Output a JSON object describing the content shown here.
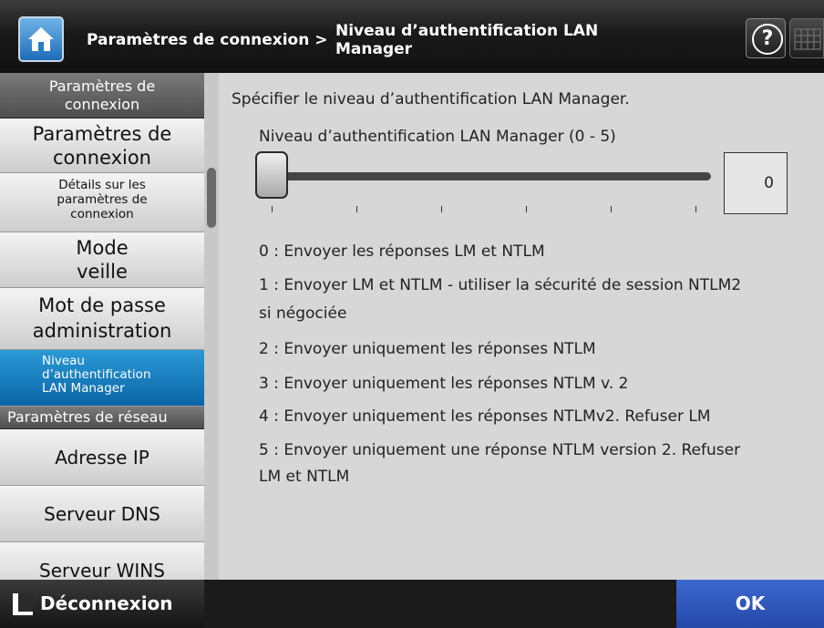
{
  "header": {
    "breadcrumb_parent": "Paramètres de connexion",
    "breadcrumb_separator": ">",
    "breadcrumb_current_line1": "Niveau d’authentification LAN",
    "breadcrumb_current_line2": "Manager",
    "help_glyph": "?"
  },
  "sidebar": {
    "section_connexion": [
      "Paramètres de",
      "connexion"
    ],
    "item_params_connexion": [
      "Paramètres de",
      "connexion"
    ],
    "item_details": [
      "Détails sur les",
      "paramètres de",
      "connexion"
    ],
    "item_mode_veille": [
      "Mode",
      "veille"
    ],
    "item_mot_de_passe": [
      "Mot de passe",
      "administration"
    ],
    "item_niveau_auth": [
      "Niveau",
      "d’authentification",
      "LAN Manager"
    ],
    "section_reseau": "Paramètres de réseau",
    "item_adresse_ip": "Adresse IP",
    "item_serveur_dns": "Serveur DNS",
    "item_serveur_wins": "Serveur WINS"
  },
  "main": {
    "instruction": "Spécifier le niveau d’authentification LAN Manager.",
    "slider_label": "Niveau d’authentification LAN Manager (0 - 5)",
    "slider_value": "0",
    "slider_min": 0,
    "slider_max": 5,
    "options": [
      [
        "0 : Envoyer les réponses LM et NTLM"
      ],
      [
        "1 : Envoyer LM et NTLM - utiliser la sécurité de session NTLM2",
        "si négociée"
      ],
      [
        "2 : Envoyer uniquement les réponses NTLM"
      ],
      [
        "3 : Envoyer uniquement les réponses NTLM v. 2"
      ],
      [
        "4 : Envoyer uniquement les réponses NTLMv2. Refuser LM"
      ],
      [
        "5 : Envoyer uniquement une réponse NTLM version 2. Refuser",
        "LM et NTLM"
      ]
    ]
  },
  "footer": {
    "logout_label": "Déconnexion",
    "ok_label": "OK"
  },
  "colors": {
    "active_item": "#0a64a6",
    "ok_button": "#2f58c0"
  },
  "icons": [
    "home-icon",
    "help-icon",
    "keyboard-icon",
    "logout-icon"
  ]
}
